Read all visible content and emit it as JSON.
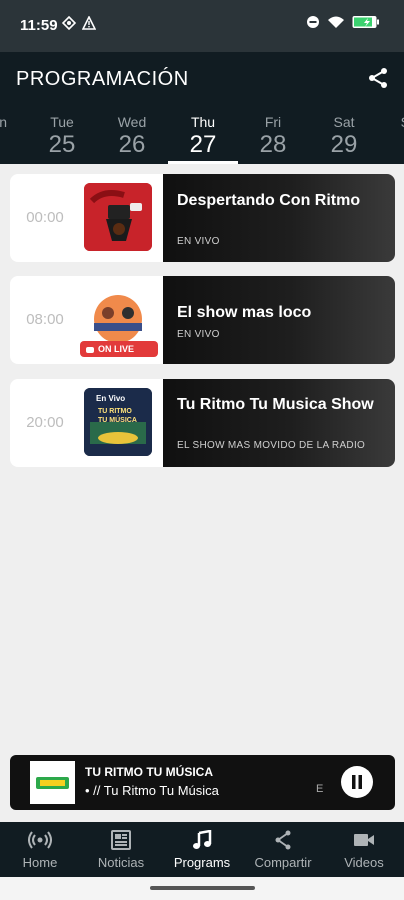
{
  "status": {
    "time": "11:59"
  },
  "header": {
    "title": "PROGRAMACIÓN"
  },
  "days": [
    {
      "name": "n",
      "num": ""
    },
    {
      "name": "Tue",
      "num": "25"
    },
    {
      "name": "Wed",
      "num": "26"
    },
    {
      "name": "Thu",
      "num": "27",
      "active": true
    },
    {
      "name": "Fri",
      "num": "28"
    },
    {
      "name": "Sat",
      "num": "29"
    },
    {
      "name": "S",
      "num": ""
    }
  ],
  "programs": [
    {
      "time": "00:00",
      "title": "Despertando Con Ritmo",
      "subtitle": "EN VIVO"
    },
    {
      "time": "08:00",
      "title": "El show mas loco",
      "subtitle": "EN VIVO",
      "badge": "ON LIVE"
    },
    {
      "time": "20:00",
      "title": "Tu Ritmo Tu Musica Show",
      "subtitle": "EL SHOW MAS MOVIDO DE LA RADIO",
      "thumb_text": [
        "En Vivo",
        "TU RITMO",
        "TU MÚSICA"
      ]
    }
  ],
  "player": {
    "title": "TU RITMO TU MÚSICA",
    "subtitle": "• // Tu Ritmo Tu Música",
    "ellipsis": "E"
  },
  "nav": [
    {
      "label": "Home",
      "icon": "radio-icon"
    },
    {
      "label": "Noticias",
      "icon": "news-icon"
    },
    {
      "label": "Programs",
      "icon": "music-note-icon",
      "active": true
    },
    {
      "label": "Compartir",
      "icon": "share-icon"
    },
    {
      "label": "Videos",
      "icon": "video-camera-icon"
    }
  ],
  "colors": {
    "header_bg": "#111c22",
    "status_bg": "#2b3439",
    "live_red": "#e23a3a"
  }
}
